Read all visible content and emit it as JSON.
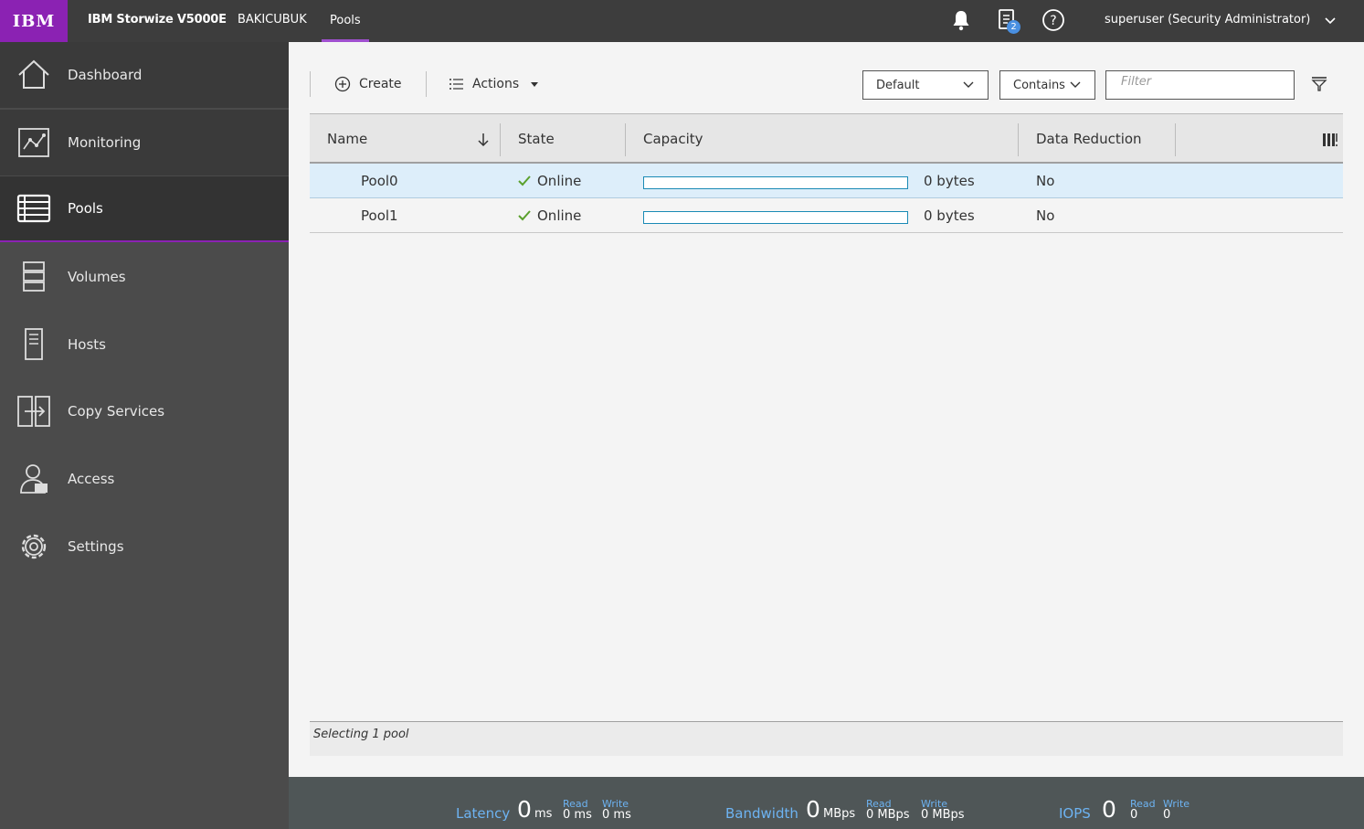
{
  "topbar": {
    "logo": "IBM",
    "product": "IBM Storwize V5000E",
    "system": "BAKICUBUK",
    "breadcrumb": "Pools",
    "tasks_count": "2",
    "user": "superuser (Security Administrator)"
  },
  "sidebar": {
    "items": [
      {
        "label": "Dashboard",
        "icon": "home-icon"
      },
      {
        "label": "Monitoring",
        "icon": "monitoring-icon"
      },
      {
        "label": "Pools",
        "icon": "pools-icon"
      },
      {
        "label": "Volumes",
        "icon": "volumes-icon"
      },
      {
        "label": "Hosts",
        "icon": "hosts-icon"
      },
      {
        "label": "Copy Services",
        "icon": "copy-services-icon"
      },
      {
        "label": "Access",
        "icon": "access-icon"
      },
      {
        "label": "Settings",
        "icon": "settings-icon"
      }
    ]
  },
  "toolbar": {
    "create_label": "Create",
    "actions_label": "Actions",
    "view_select": "Default",
    "match_select": "Contains",
    "filter_placeholder": "Filter"
  },
  "table": {
    "columns": [
      "Name",
      "State",
      "Capacity",
      "Data Reduction"
    ],
    "rows": [
      {
        "name": "Pool0",
        "state": "Online",
        "capacity": "0 bytes",
        "capacity_used_fraction": 0,
        "data_reduction": "No",
        "selected": true
      },
      {
        "name": "Pool1",
        "state": "Online",
        "capacity": "0 bytes",
        "capacity_used_fraction": 0,
        "data_reduction": "No",
        "selected": false
      }
    ],
    "status": "Selecting 1 pool"
  },
  "perf": {
    "latency_label": "Latency",
    "latency_value": "0",
    "latency_unit": "ms",
    "latency_read_label": "Read",
    "latency_read": "0 ms",
    "latency_write_label": "Write",
    "latency_write": "0 ms",
    "bandwidth_label": "Bandwidth",
    "bandwidth_value": "0",
    "bandwidth_unit": "MBps",
    "bandwidth_read_label": "Read",
    "bandwidth_read": "0 MBps",
    "bandwidth_write_label": "Write",
    "bandwidth_write": "0 MBps",
    "iops_label": "IOPS",
    "iops_value": "0",
    "iops_read_label": "Read",
    "iops_read": "0",
    "iops_write_label": "Write",
    "iops_write": "0"
  },
  "colors": {
    "brand": "#8b22b3",
    "topbar": "#3d3d3d",
    "sidebar": "#4b4b4b",
    "online_check": "#5aa02c",
    "capacity_bar": "#1a8ab5",
    "selected_row": "#ddeefa",
    "perf_label": "#6db3f2"
  }
}
